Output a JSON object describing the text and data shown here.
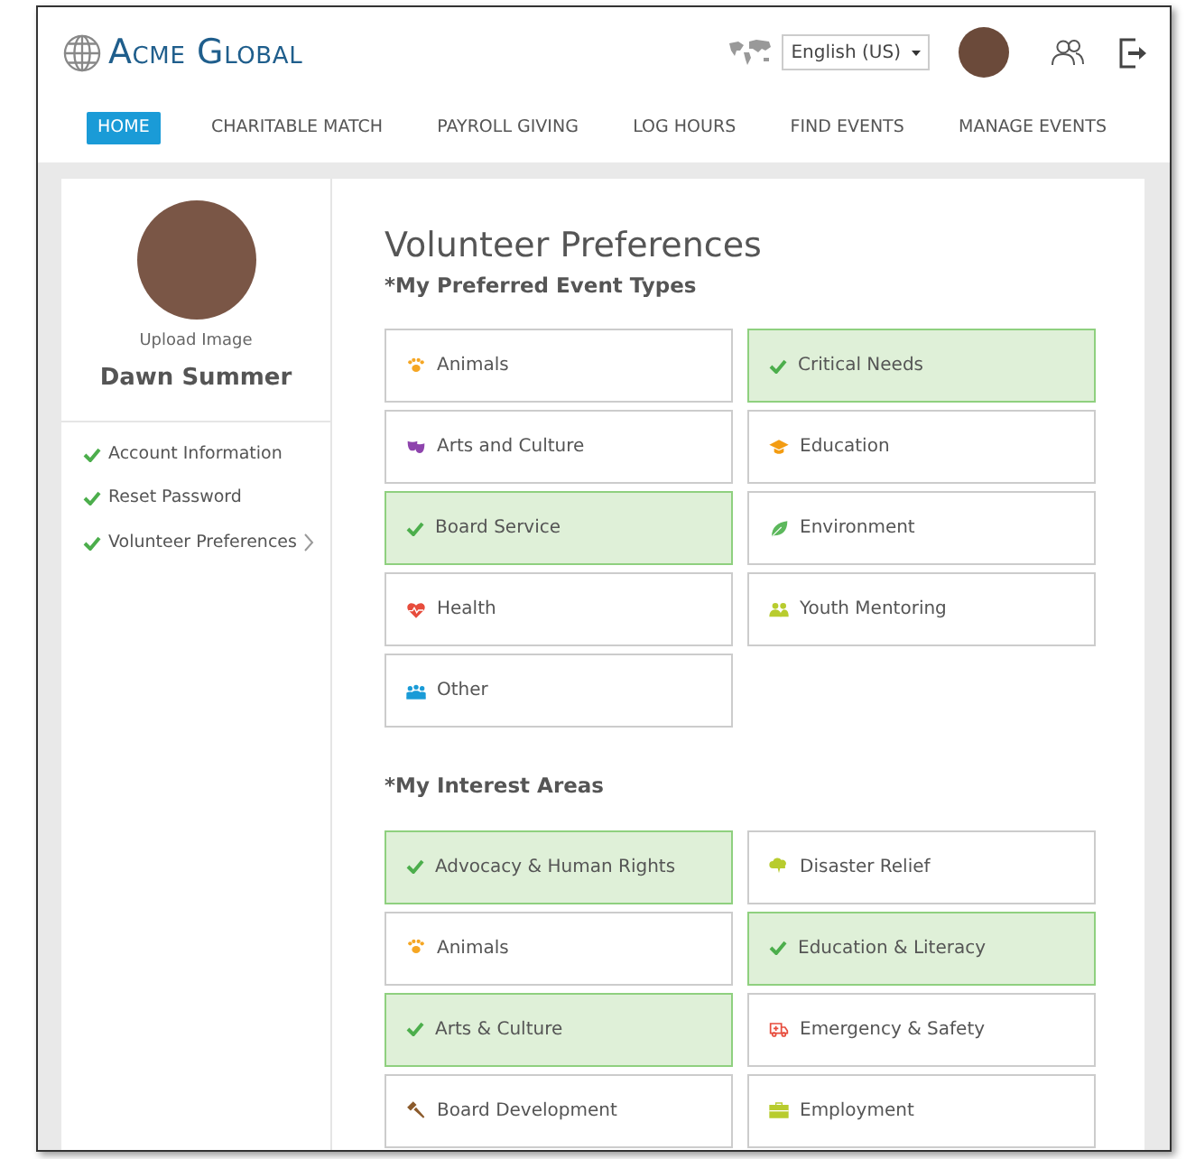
{
  "brand": {
    "name": "Acme Global"
  },
  "language": {
    "value": "English (US)"
  },
  "nav": [
    {
      "label": "HOME",
      "selected": true
    },
    {
      "label": "CHARITABLE MATCH",
      "selected": false
    },
    {
      "label": "PAYROLL GIVING",
      "selected": false
    },
    {
      "label": "LOG HOURS",
      "selected": false
    },
    {
      "label": "FIND EVENTS",
      "selected": false
    },
    {
      "label": "MANAGE EVENTS",
      "selected": false
    }
  ],
  "profile": {
    "upload_label": "Upload Image",
    "name": "Dawn Summer"
  },
  "sidebar": {
    "items": [
      {
        "label": "Account Information",
        "checked": true,
        "selected": false
      },
      {
        "label": "Reset Password",
        "checked": true,
        "selected": false
      },
      {
        "label": "Volunteer Preferences",
        "checked": true,
        "selected": true
      }
    ]
  },
  "page_title": "Volunteer Preferences",
  "sections": [
    {
      "title": "*My Preferred Event Types",
      "options": [
        {
          "label": "Animals",
          "kind": "paw",
          "selected": false
        },
        {
          "label": "Critical Needs",
          "selected": true
        },
        {
          "label": "Arts and Culture",
          "kind": "masks",
          "selected": false
        },
        {
          "label": "Education",
          "kind": "cap",
          "selected": false
        },
        {
          "label": "Board Service",
          "selected": true
        },
        {
          "label": "Environment",
          "kind": "leaf",
          "selected": false
        },
        {
          "label": "Health",
          "kind": "heart",
          "selected": false
        },
        {
          "label": "Youth Mentoring",
          "kind": "pair",
          "selected": false
        },
        {
          "label": "Other",
          "kind": "group",
          "selected": false
        }
      ]
    },
    {
      "title": "*My Interest Areas",
      "options": [
        {
          "label": "Advocacy & Human Rights",
          "selected": true
        },
        {
          "label": "Disaster Relief",
          "kind": "cloud",
          "selected": false
        },
        {
          "label": "Animals",
          "kind": "paw",
          "selected": false
        },
        {
          "label": "Education & Literacy",
          "selected": true
        },
        {
          "label": "Arts & Culture",
          "selected": true
        },
        {
          "label": "Emergency & Safety",
          "kind": "ambulance",
          "selected": false
        },
        {
          "label": "Board Development",
          "kind": "gavel",
          "selected": false
        },
        {
          "label": "Employment",
          "kind": "briefcase",
          "selected": false
        }
      ]
    }
  ]
}
